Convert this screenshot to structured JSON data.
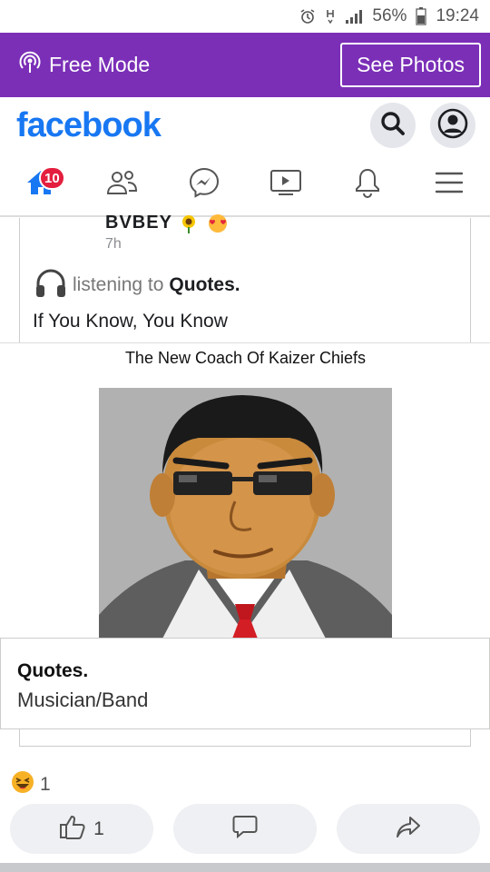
{
  "status_bar": {
    "battery": "56%",
    "time": "19:24",
    "icons": [
      "alarm-icon",
      "network-h-icon",
      "signal-icon",
      "battery-icon"
    ]
  },
  "free_mode": {
    "label": "Free Mode",
    "see_photos": "See Photos",
    "color": "#7b2fb7"
  },
  "header": {
    "logo": "facebook",
    "logo_color": "#1877f2"
  },
  "nav": {
    "home_badge": "10",
    "items": [
      "home-icon",
      "friends-icon",
      "messenger-icon",
      "watch-icon",
      "notifications-icon",
      "menu-icon"
    ]
  },
  "post": {
    "author": "BVBEY",
    "time": "7h",
    "activity_prefix": "listening to",
    "activity_target": "Quotes.",
    "text": "If You Know, You Know",
    "media_caption": "The New Coach Of Kaizer Chiefs"
  },
  "page_card": {
    "name": "Quotes.",
    "category": "Musician/Band"
  },
  "reactions": {
    "count": "1"
  },
  "actions": {
    "like_count": "1"
  }
}
